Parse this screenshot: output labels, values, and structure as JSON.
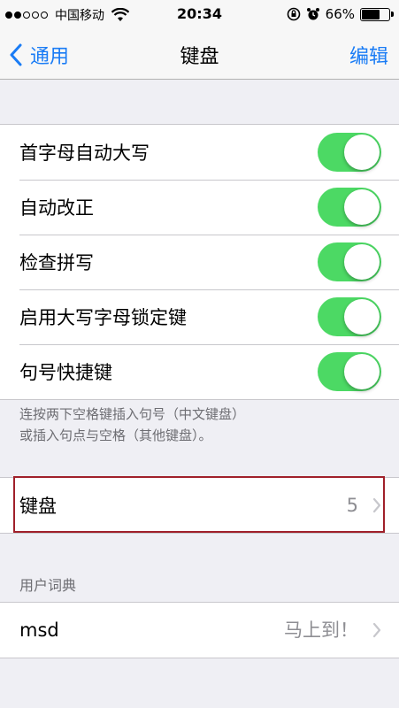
{
  "status_bar": {
    "carrier": "中国移动",
    "time": "20:34",
    "battery_text": "66%",
    "battery_level": 0.66,
    "signal_bars_filled": 2,
    "signal_bars_total": 5
  },
  "nav": {
    "back_label": "通用",
    "title": "键盘",
    "edit_label": "编辑"
  },
  "toggles": [
    {
      "label": "首字母自动大写",
      "on": true
    },
    {
      "label": "自动改正",
      "on": true
    },
    {
      "label": "检查拼写",
      "on": true
    },
    {
      "label": "启用大写字母锁定键",
      "on": true
    },
    {
      "label": "句号快捷键",
      "on": true
    }
  ],
  "shortcut_note": {
    "line1": "连按两下空格键插入句号（中文键盘）",
    "line2": "或插入句点与空格（其他键盘）。"
  },
  "keyboards_row": {
    "label": "键盘",
    "value": "5"
  },
  "user_dictionary": {
    "header": "用户词典",
    "entry_label": "msd",
    "entry_value": "马上到！"
  },
  "colors": {
    "accent": "#1a7cf5",
    "toggle_on": "#4cd964",
    "highlight_border": "#a0202a"
  }
}
